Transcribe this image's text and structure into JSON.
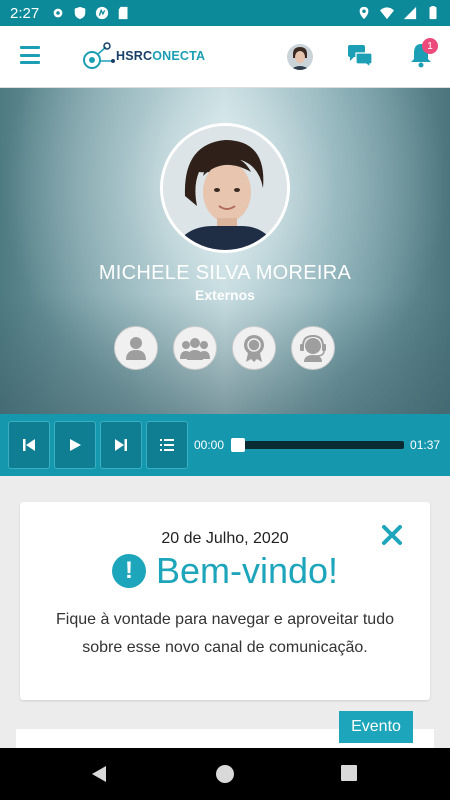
{
  "status_bar": {
    "time": "2:27",
    "icons": [
      "settings-icon",
      "shield-icon",
      "media-icon",
      "sd-card-icon",
      "location-icon",
      "wifi-icon",
      "signal-icon",
      "battery-icon"
    ]
  },
  "header": {
    "logo_part1": "HSRC",
    "logo_part2": "ONECTA",
    "notification_count": "1",
    "accent_color": "#1c9fb4",
    "badge_color": "#ec4a7a"
  },
  "profile": {
    "name": "MICHELE SILVA MOREIRA",
    "role": "Externos",
    "actions": [
      "user-profile-icon",
      "group-icon",
      "award-icon",
      "support-agent-icon"
    ]
  },
  "player": {
    "current_time": "00:00",
    "total_time": "01:37",
    "progress": 0.0,
    "buttons": [
      "previous-icon",
      "play-icon",
      "next-icon",
      "playlist-icon"
    ]
  },
  "welcome_card": {
    "date": "20 de Julho, 2020",
    "title": "Bem-vindo!",
    "icon_glyph": "!",
    "message": "Fique à vontade para navegar e aproveitar tudo sobre esse novo canal de comunicação."
  },
  "feed": {
    "tag_label": "Evento"
  }
}
